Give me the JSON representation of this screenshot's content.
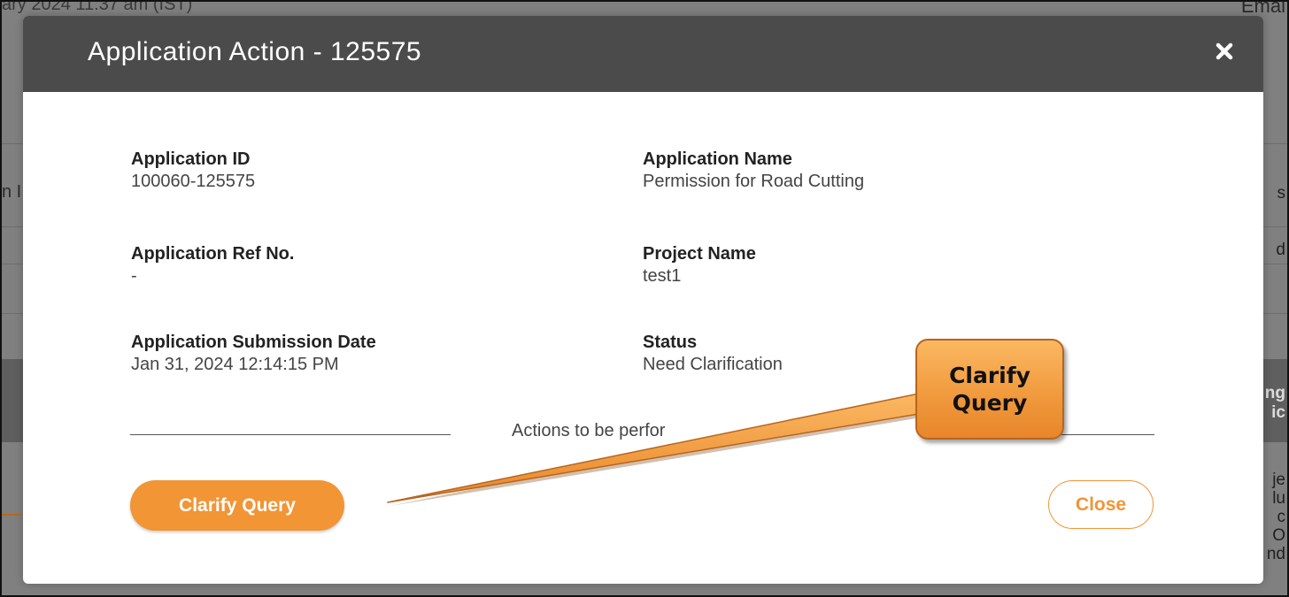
{
  "background": {
    "top_left_fragment": "ary 2024 11:37 am (IST)",
    "top_right_fragment": "Emai",
    "left_fragment": "n I",
    "right_fragments": [
      "s",
      "d",
      "ng",
      "ic"
    ],
    "right_bottom_fragments": [
      "je",
      "lu",
      "c",
      "O",
      "nd"
    ]
  },
  "modal": {
    "title": "Application Action - 125575",
    "close_icon": "close-x-icon",
    "fields": {
      "application_id": {
        "label": "Application ID",
        "value": "100060-125575"
      },
      "application_name": {
        "label": "Application Name",
        "value": "Permission for Road Cutting"
      },
      "application_ref_no": {
        "label": "Application Ref No.",
        "value": "-"
      },
      "project_name": {
        "label": "Project Name",
        "value": "test1"
      },
      "submission_date": {
        "label": "Application Submission Date",
        "value": "Jan 31, 2024 12:14:15 PM"
      },
      "status": {
        "label": "Status",
        "value": "Need Clarification"
      }
    },
    "actions_caption": "Actions to be perfor",
    "clarify_button": "Clarify Query",
    "close_button": "Close"
  },
  "callout": {
    "text": "Clarify Query"
  },
  "colors": {
    "header": "#4b4b4b",
    "accent": "#f19535",
    "overlay": "#808080"
  }
}
